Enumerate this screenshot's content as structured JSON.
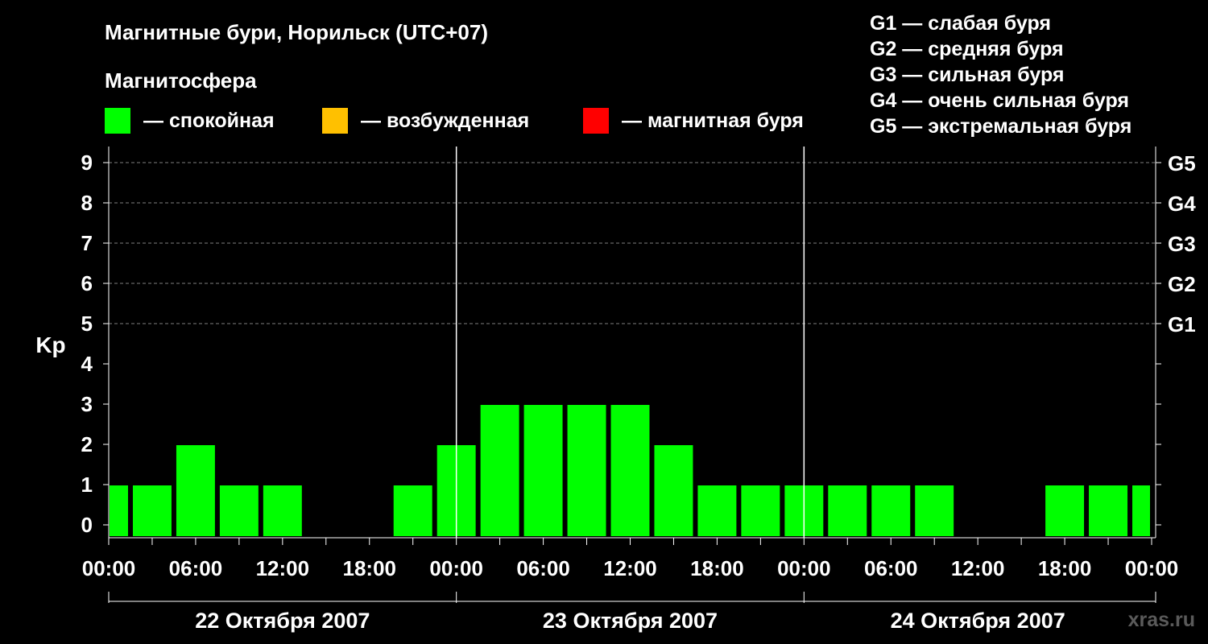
{
  "chart_data": {
    "type": "bar",
    "title": "Магнитные бури, Норильск (UTC+07)",
    "legend_title": "Магнитосфера",
    "legend": [
      {
        "label": "— спокойная",
        "color": "#00ff00"
      },
      {
        "label": "— возбужденная",
        "color": "#ffc000"
      },
      {
        "label": "— магнитная буря",
        "color": "#ff0000"
      }
    ],
    "storm_scale": [
      "G1 — слабая буря",
      "G2 — средняя буря",
      "G3 — сильная буря",
      "G4 — очень сильная буря",
      "G5 — экстремальная буря"
    ],
    "ylabel": "Kp",
    "ylim": [
      0,
      9
    ],
    "y_ticks": [
      "0",
      "1",
      "2",
      "3",
      "4",
      "5",
      "6",
      "7",
      "8",
      "9"
    ],
    "right_axis": [
      {
        "y": 5,
        "label": "G1"
      },
      {
        "y": 6,
        "label": "G2"
      },
      {
        "y": 7,
        "label": "G3"
      },
      {
        "y": 8,
        "label": "G4"
      },
      {
        "y": 9,
        "label": "G5"
      }
    ],
    "x_tick_labels": [
      "00:00",
      "06:00",
      "12:00",
      "18:00",
      "00:00",
      "06:00",
      "12:00",
      "18:00",
      "00:00",
      "06:00",
      "12:00",
      "18:00",
      "00:00"
    ],
    "days": [
      "22 Октября 2007",
      "23 Октября 2007",
      "24 Октября 2007"
    ],
    "interval_hours": 3,
    "values": [
      1,
      1,
      2,
      1,
      1,
      0,
      0,
      1,
      2,
      3,
      3,
      3,
      3,
      2,
      1,
      1,
      1,
      1,
      1,
      1,
      0,
      0,
      1,
      1,
      1
    ],
    "grid": "dashed at Kp 5–9",
    "watermark": "xras.ru"
  }
}
